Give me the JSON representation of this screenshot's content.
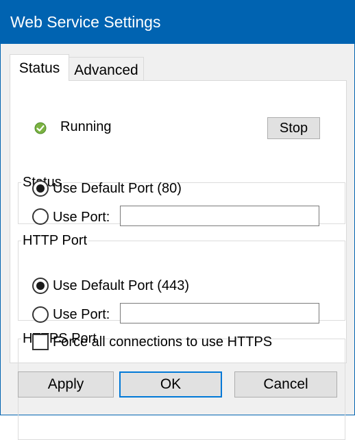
{
  "window": {
    "title": "Web Service Settings"
  },
  "tabs": [
    {
      "label": "Status",
      "selected": true
    },
    {
      "label": "Advanced",
      "selected": false
    }
  ],
  "status_group": {
    "legend": "Status",
    "state_text": "Running",
    "state_icon": "check-circle-icon",
    "state_color": "#6aa84f",
    "stop_label": "Stop"
  },
  "http_group": {
    "legend": "HTTP Port",
    "default_option": "Use Default Port (80)",
    "default_selected": true,
    "custom_option": "Use Port:",
    "custom_value": ""
  },
  "https_group": {
    "legend": "HTTPS Port",
    "default_option": "Use Default Port (443)",
    "default_selected": true,
    "custom_option": "Use Port:",
    "custom_value": "",
    "force_https_label": "Force all connections to use HTTPS",
    "force_https_checked": false
  },
  "buttons": {
    "apply": "Apply",
    "ok": "OK",
    "cancel": "Cancel"
  },
  "colors": {
    "titlebar": "#0063b1",
    "accent": "#0078d7"
  }
}
